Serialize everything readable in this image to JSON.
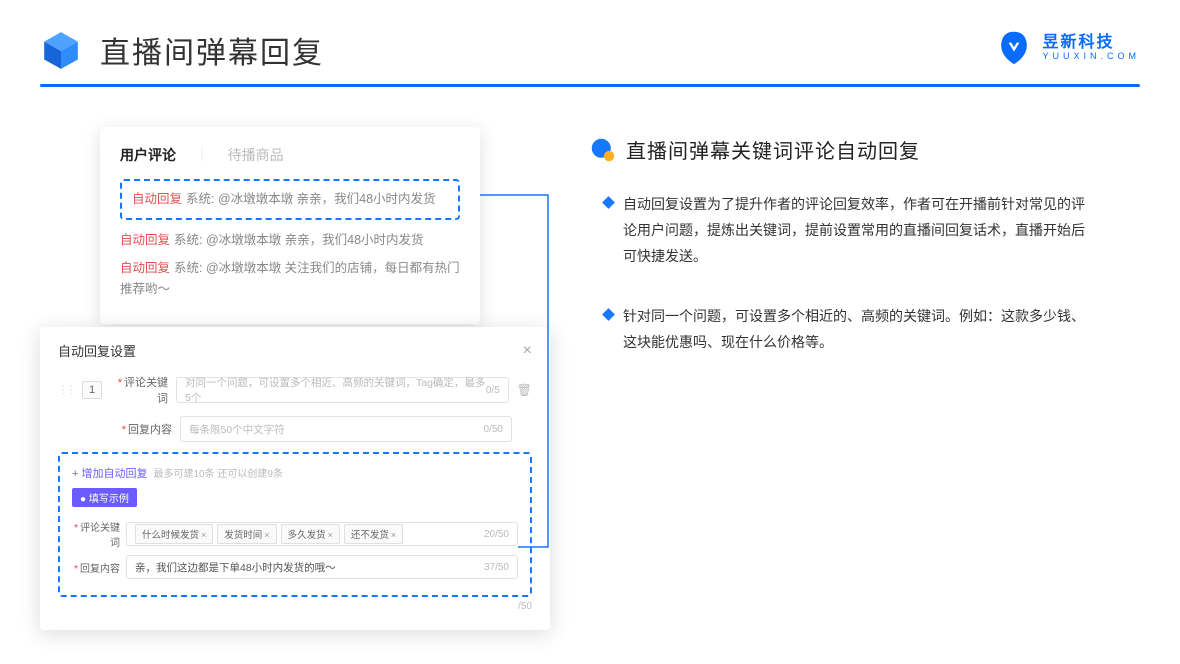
{
  "header": {
    "title": "直播间弹幕回复",
    "brand_cn": "昱新科技",
    "brand_en": "YUUXIN.COM"
  },
  "panel1": {
    "tab_active": "用户评论",
    "tab_inactive": "待播商品",
    "highlighted": {
      "tag": "自动回复",
      "body": "系统: @冰墩墩本墩 亲亲，我们48小时内发货"
    },
    "c2": {
      "tag": "自动回复",
      "body": "系统: @冰墩墩本墩 亲亲，我们48小时内发货"
    },
    "c3": {
      "tag": "自动回复",
      "body": "系统: @冰墩墩本墩 关注我们的店铺，每日都有热门推荐哟～"
    }
  },
  "panel2": {
    "title": "自动回复设置",
    "num": "1",
    "row1_label": "评论关键词",
    "row1_placeholder": "对同一个问题，可设置多个相近、高频的关键词，Tag确定，最多5个",
    "row1_counter": "0/5",
    "row2_label": "回复内容",
    "row2_placeholder": "每条限50个中文字符",
    "row2_counter": "0/50",
    "add_link": "+ 增加自动回复",
    "add_hint": "最多可建10条 还可以创建9条",
    "ex_badge": "● 填写示例",
    "ex_r1_label": "评论关键词",
    "ex_tags": [
      "什么时候发货",
      "发货时间",
      "多久发货",
      "还不发货"
    ],
    "ex_r1_counter": "20/50",
    "ex_r2_label": "回复内容",
    "ex_r2_value": "亲，我们这边都是下单48小时内发货的哦～",
    "ex_r2_counter": "37/50",
    "bottom_counter": "/50"
  },
  "right": {
    "title": "直播间弹幕关键词评论自动回复",
    "b1": "自动回复设置为了提升作者的评论回复效率，作者可在开播前针对常见的评论用户问题，提炼出关键词，提前设置常用的直播间回复话术，直播开始后可快捷发送。",
    "b2": "针对同一个问题，可设置多个相近的、高频的关键词。例如：这款多少钱、这块能优惠吗、现在什么价格等。"
  }
}
